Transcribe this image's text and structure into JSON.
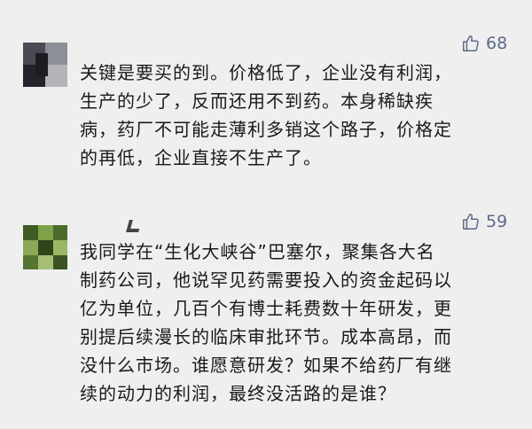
{
  "comments": [
    {
      "likes": "68",
      "lines": [
        "关键是要买的到。价格低了，企业没有利润，",
        "生产的少了，反而还用不到药。本身稀缺疾",
        "病，药厂不可能走薄利多销这个路子，价格定",
        "的再低，企业直接不生产了。"
      ]
    },
    {
      "likes": "59",
      "lines": [
        "我同学在“生化大峡谷”巴塞尔，聚集各大名",
        "制药公司，他说罕见药需要投入的资金起码以",
        "亿为单位，几百个有博士耗费数十年研发，更",
        "别提后续漫长的临床审批环节。成本高昂，而",
        "没什么市场。谁愿意研发？如果不给药厂有继",
        "续的动力的利润，最终没活路的是谁？"
      ]
    }
  ]
}
